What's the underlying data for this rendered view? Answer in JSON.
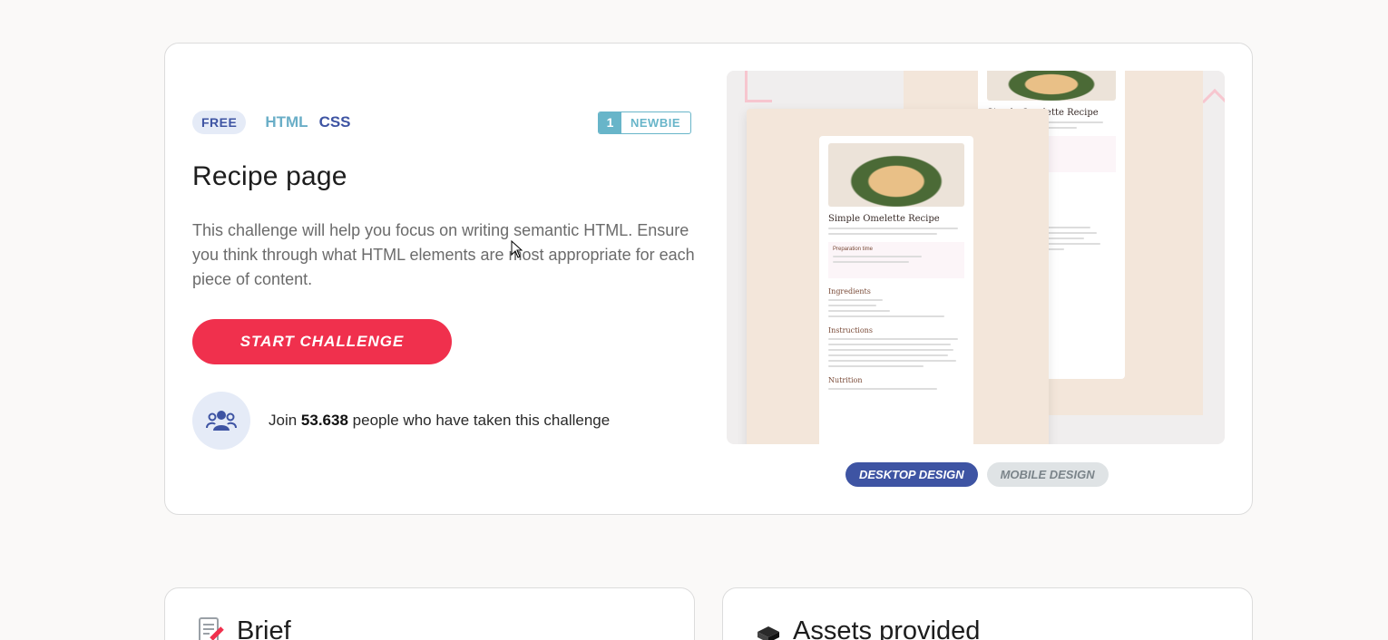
{
  "challenge": {
    "pricing": "FREE",
    "technologies": [
      "HTML",
      "CSS"
    ],
    "level": {
      "number": "1",
      "name": "NEWBIE"
    },
    "title": "Recipe page",
    "description": "This challenge will help you focus on writing semantic HTML. Ensure you think through what HTML elements are most appropriate for each piece of content.",
    "start_label": "START CHALLENGE",
    "join": {
      "prefix": "Join",
      "count": "53.638",
      "suffix": "people who have taken this challenge"
    }
  },
  "preview": {
    "recipe_title": "Simple Omelette Recipe",
    "sections": [
      "Preparation time",
      "Ingredients",
      "Instructions",
      "Nutrition"
    ],
    "switch": {
      "desktop_label": "DESKTOP DESIGN",
      "mobile_label": "MOBILE DESIGN",
      "active": "desktop"
    }
  },
  "cards": {
    "brief_title": "Brief",
    "assets_title": "Assets provided"
  },
  "colors": {
    "accent_red": "#f0304d",
    "brand_blue": "#3e54a3",
    "teal": "#68b5c9"
  }
}
